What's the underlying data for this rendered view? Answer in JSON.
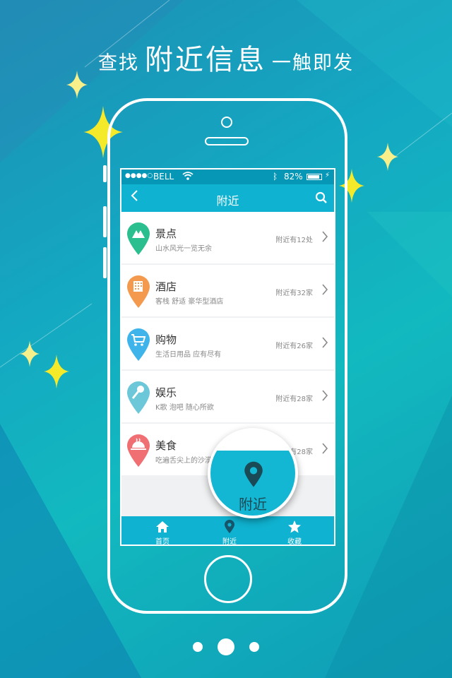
{
  "headline": {
    "part1": "查找",
    "part2": "附近信息",
    "part3": "一触即发"
  },
  "status_bar": {
    "carrier": "BELL",
    "battery": "82%"
  },
  "nav": {
    "title": "附近"
  },
  "items": [
    {
      "title": "景点",
      "subtitle": "山水风光一览无余",
      "count": "附近有12处",
      "color": "#2bbf8f",
      "icon": "mountain-icon"
    },
    {
      "title": "酒店",
      "subtitle": "客栈  舒适  豪华型酒店",
      "count": "附近有32家",
      "color": "#f39a4f",
      "icon": "building-icon"
    },
    {
      "title": "购物",
      "subtitle": "生活日用品  应有尽有",
      "count": "附近有26家",
      "color": "#3fb4ea",
      "icon": "cart-icon"
    },
    {
      "title": "娱乐",
      "subtitle": "K歌  泡吧  随心所欲",
      "count": "附近有28家",
      "color": "#6cc8d9",
      "icon": "microphone-icon"
    },
    {
      "title": "美食",
      "subtitle": "吃遍舌尖上的沙漠",
      "count": "附近有28家",
      "color": "#f06f73",
      "icon": "food-dish-icon"
    }
  ],
  "tabs": [
    {
      "label": "首页",
      "icon": "home-icon"
    },
    {
      "label": "附近",
      "icon": "location-pin-icon"
    },
    {
      "label": "收藏",
      "icon": "star-icon"
    }
  ],
  "bubble": {
    "label": "附近"
  },
  "colors": {
    "primary": "#0fb2d0",
    "status_bar": "#0697b6"
  }
}
